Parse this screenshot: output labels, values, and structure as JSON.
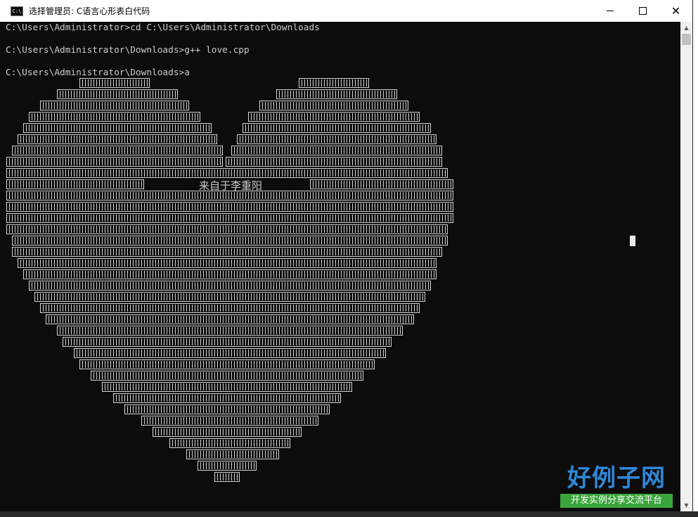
{
  "window": {
    "title": "选择管理员:  C语言心形表白代码",
    "icon": "console-icon",
    "controls": [
      "minimize-icon",
      "maximize-icon",
      "close-icon"
    ],
    "close_glyph": "✕"
  },
  "console": {
    "background": "#0c0c0c",
    "text_color": "#cccccc",
    "lines": [
      "C:\\Users\\Administrator>cd C:\\Users\\Administrator\\Downloads",
      "",
      "C:\\Users\\Administrator\\Downloads>g++ love.cpp",
      "",
      "C:\\Users\\Administrator\\Downloads>a"
    ],
    "heart_caption": "来自于李重阳",
    "heart_glyph": "▯"
  },
  "scrollbar": {
    "up_glyph": "▲",
    "down_glyph": "▼"
  },
  "watermark": {
    "title": "好例子网",
    "subtitle": "开发实例分享交流平台",
    "title_color": "#2f86d6",
    "subtitle_bg": "#3aa53a"
  }
}
